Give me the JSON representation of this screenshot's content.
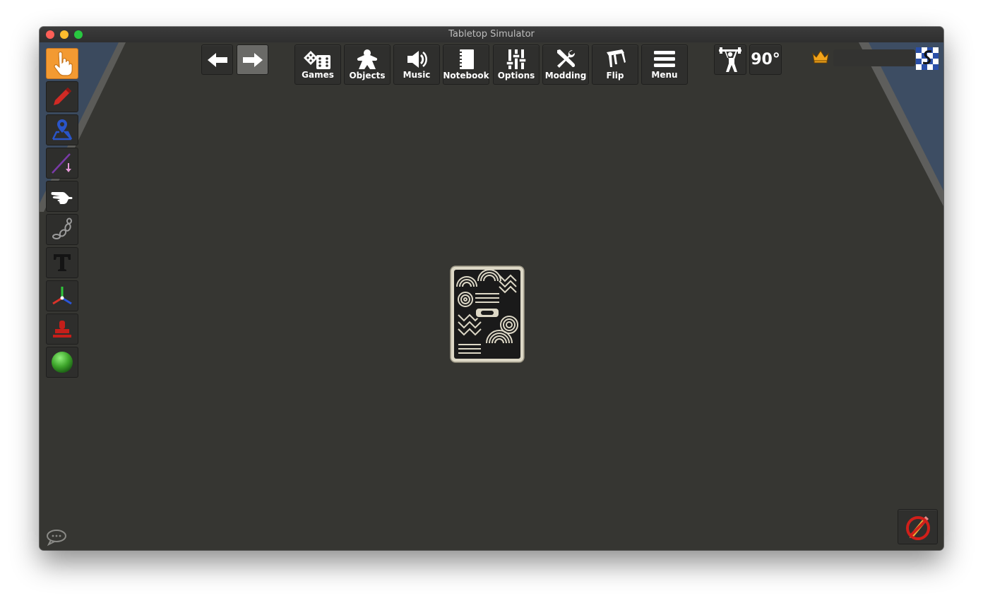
{
  "window": {
    "title": "Tabletop Simulator"
  },
  "toolbar": {
    "back_icon": "arrow-left-icon",
    "forward_icon": "arrow-right-icon",
    "items": [
      {
        "label": "Games",
        "icon": "dice-icon"
      },
      {
        "label": "Objects",
        "icon": "meeple-icon"
      },
      {
        "label": "Music",
        "icon": "speaker-icon"
      },
      {
        "label": "Notebook",
        "icon": "notebook-icon"
      },
      {
        "label": "Options",
        "icon": "sliders-icon"
      },
      {
        "label": "Modding",
        "icon": "tools-icon"
      },
      {
        "label": "Flip",
        "icon": "flip-table-icon"
      },
      {
        "label": "Menu",
        "icon": "hamburger-icon"
      }
    ],
    "rotation_label": "90°"
  },
  "host": {
    "name": "",
    "icon": "crown-icon"
  },
  "tools": [
    "pointer-tool",
    "draw-tool",
    "zone-tool",
    "line-tool",
    "gizmo-hand-tool",
    "joint-tool",
    "text-tool",
    "axis-tool",
    "snap-tool",
    "color-tool"
  ],
  "colors": {
    "table": "#363632",
    "accent_orange": "#f39a32",
    "player_color": "#3da42a"
  }
}
